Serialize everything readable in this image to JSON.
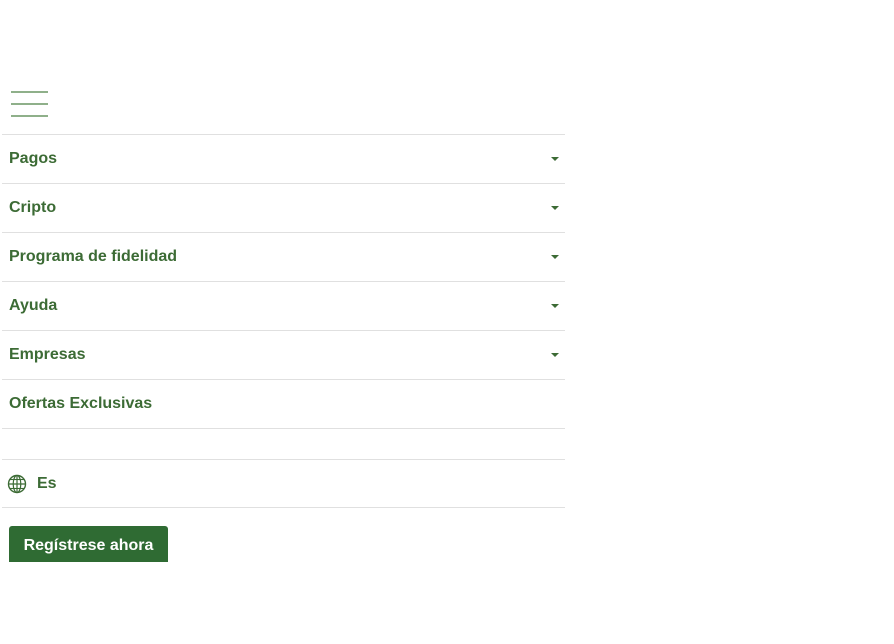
{
  "menu": {
    "icon": "hamburger-menu-icon",
    "items": [
      {
        "label": "Pagos",
        "has_dropdown": true
      },
      {
        "label": "Cripto",
        "has_dropdown": true
      },
      {
        "label": "Programa de fidelidad",
        "has_dropdown": true
      },
      {
        "label": "Ayuda",
        "has_dropdown": true
      },
      {
        "label": "Empresas",
        "has_dropdown": true
      },
      {
        "label": "Ofertas Exclusivas",
        "has_dropdown": false
      }
    ]
  },
  "language": {
    "icon": "globe-icon",
    "label": "Es"
  },
  "cta": {
    "register_label": "Regístrese ahora"
  },
  "colors": {
    "brand_green": "#2f6b33",
    "text_green": "#3c6b35",
    "hamburger_green": "#8fb08a",
    "divider": "#e0e0e0"
  }
}
